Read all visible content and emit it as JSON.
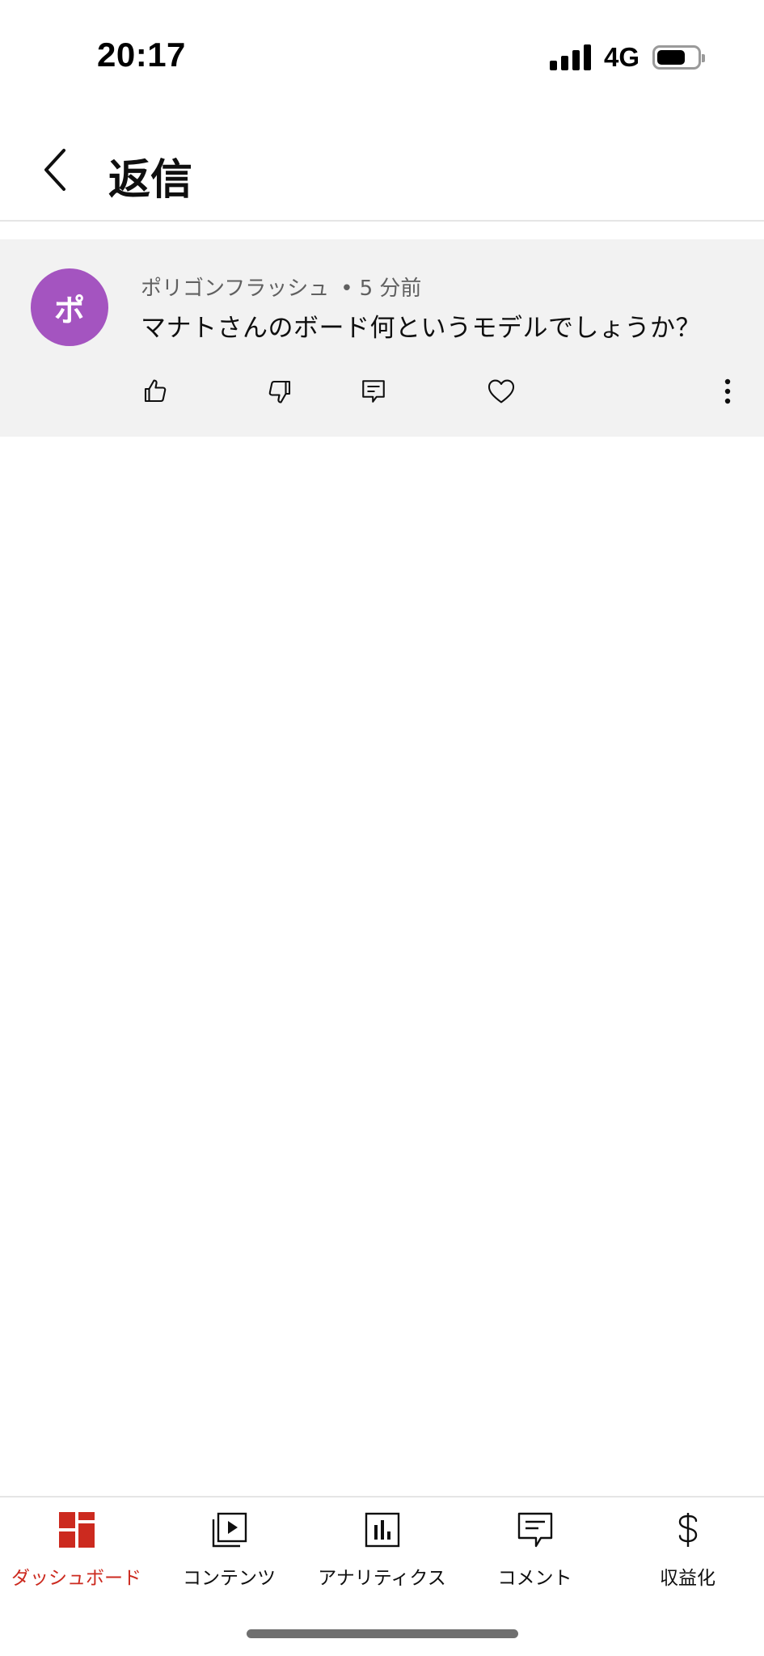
{
  "status_bar": {
    "time": "20:17",
    "network": "4G"
  },
  "header": {
    "title": "返信",
    "back_icon": "chevron-left-icon"
  },
  "comment": {
    "avatar_letter": "ポ",
    "avatar_color": "#a454c0",
    "author": "ポリゴンフラッシュ",
    "time_ago": "5 分前",
    "text": "マナトさんのボード何というモデルでしょうか？",
    "actions": [
      "like-icon",
      "dislike-icon",
      "reply-icon",
      "heart-icon",
      "more-icon"
    ]
  },
  "bottom_nav": {
    "active_color": "#cc2a1f",
    "items": [
      {
        "label": "ダッシュボード",
        "icon": "dashboard-icon"
      },
      {
        "label": "コンテンツ",
        "icon": "content-icon"
      },
      {
        "label": "アナリティクス",
        "icon": "analytics-icon"
      },
      {
        "label": "コメント",
        "icon": "comment-icon"
      },
      {
        "label": "収益化",
        "icon": "dollar-icon"
      }
    ]
  }
}
